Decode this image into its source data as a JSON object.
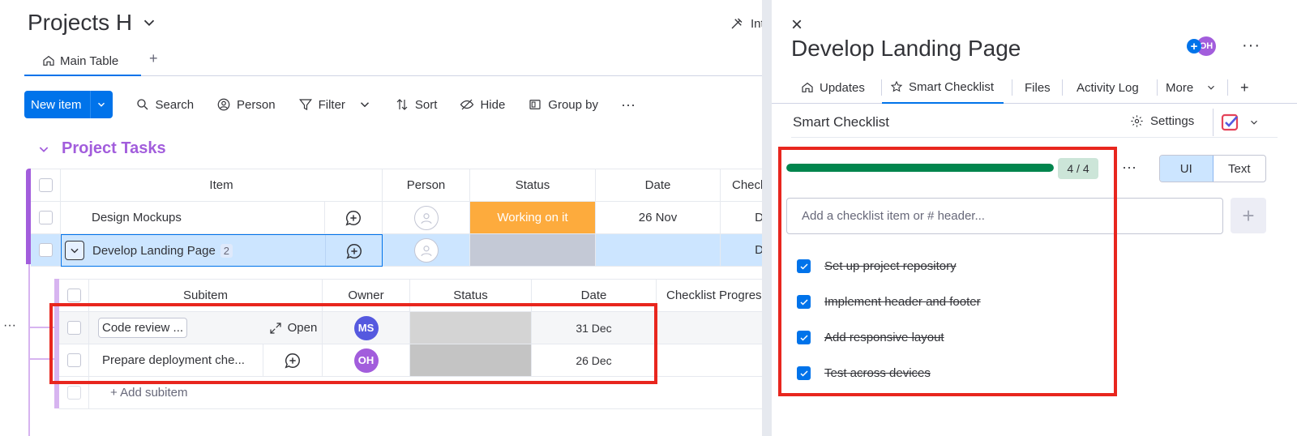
{
  "board": {
    "title": "Projects H",
    "integrate_label": "Int",
    "view_tab": "Main Table",
    "view_add": "+",
    "toolbar": {
      "new_item": "New item",
      "search": "Search",
      "person": "Person",
      "filter": "Filter",
      "sort": "Sort",
      "hide": "Hide",
      "group_by": "Group by",
      "more": "···"
    },
    "group": {
      "title": "Project Tasks",
      "color": "#a25ddc",
      "columns": [
        "Item",
        "Person",
        "Status",
        "Date",
        "Checkl"
      ],
      "rows": [
        {
          "item": "Design Mockups",
          "status": "Working on it",
          "date": "26 Nov",
          "checklist": "D"
        },
        {
          "item": "Develop Landing Page",
          "subitem_count": "2",
          "status": "",
          "date": "",
          "checklist": "D"
        }
      ]
    },
    "subitems": {
      "columns": [
        "Subitem",
        "Owner",
        "Status",
        "Date",
        "Checklist Progres"
      ],
      "rows": [
        {
          "name": "Code review ...",
          "open_label": "Open",
          "owner": "MS",
          "owner_color": "#5559df",
          "date": "31 Dec"
        },
        {
          "name": "Prepare deployment che...",
          "owner": "OH",
          "owner_color": "#a25ddc",
          "date": "26 Dec"
        }
      ],
      "add_label": "+ Add subitem"
    },
    "side_more": "···"
  },
  "panel": {
    "close": "×",
    "title": "Develop Landing Page",
    "avatar": "OH",
    "more": "···",
    "tabs": [
      "Updates",
      "Smart Checklist",
      "Files",
      "Activity Log",
      "More",
      "+"
    ],
    "active_tab": "Smart Checklist",
    "section_title": "Smart Checklist",
    "settings_label": "Settings",
    "progress": {
      "label": "4 / 4",
      "fraction": 1.0,
      "color": "#00854d"
    },
    "progress_more": "···",
    "modes": [
      "UI",
      "Text"
    ],
    "active_mode": "UI",
    "input_placeholder": "Add a checklist item or # header...",
    "add_button": "+",
    "items": [
      {
        "text": "Set up project repository",
        "checked": true
      },
      {
        "text": "Implement header and footer",
        "checked": true
      },
      {
        "text": "Add responsive layout",
        "checked": true
      },
      {
        "text": "Test across devices",
        "checked": true
      }
    ]
  },
  "colors": {
    "accent": "#0073ea",
    "working": "#fdab3d",
    "highlight": "#e8261e"
  }
}
